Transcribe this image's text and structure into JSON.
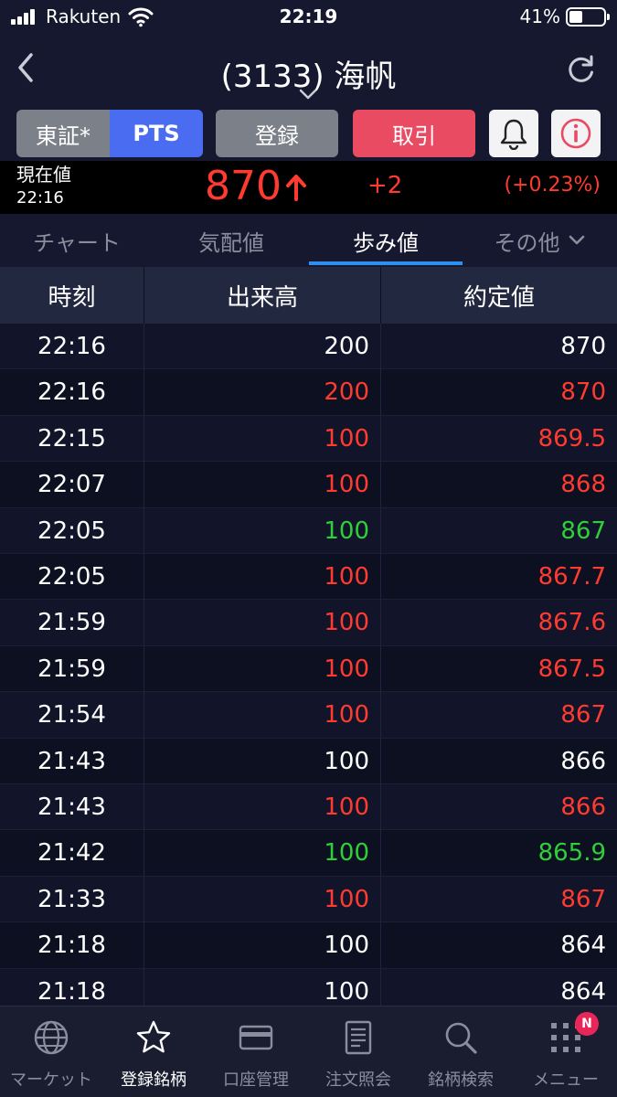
{
  "status_bar": {
    "carrier": "Rakuten",
    "time": "22:19",
    "battery": "41%",
    "battery_level": 0.41
  },
  "header": {
    "title": "(3133) 海帆"
  },
  "buttons": {
    "tosho": "東証*",
    "pts": "PTS",
    "register": "登録",
    "trade": "取引"
  },
  "quote": {
    "label": "現在値",
    "time": "22:16",
    "price": "870",
    "change": "+2",
    "change_pct": "(+0.23%)",
    "up_color": "#ff3b30"
  },
  "tabs": [
    {
      "label": "チャート"
    },
    {
      "label": "気配値"
    },
    {
      "label": "歩み値"
    },
    {
      "label": "その他"
    }
  ],
  "active_tab": "歩み値",
  "table": {
    "headers": {
      "time": "時刻",
      "volume": "出来高",
      "price": "約定値"
    },
    "colors": {
      "white": "#ffffff",
      "red": "#ff3b30",
      "green": "#2fcf3a"
    },
    "rows": [
      {
        "time": "22:16",
        "volume": "200",
        "price": "870",
        "color": "white"
      },
      {
        "time": "22:16",
        "volume": "200",
        "price": "870",
        "color": "red"
      },
      {
        "time": "22:15",
        "volume": "100",
        "price": "869.5",
        "color": "red"
      },
      {
        "time": "22:07",
        "volume": "100",
        "price": "868",
        "color": "red"
      },
      {
        "time": "22:05",
        "volume": "100",
        "price": "867",
        "color": "green"
      },
      {
        "time": "22:05",
        "volume": "100",
        "price": "867.7",
        "color": "red"
      },
      {
        "time": "21:59",
        "volume": "100",
        "price": "867.6",
        "color": "red"
      },
      {
        "time": "21:59",
        "volume": "100",
        "price": "867.5",
        "color": "red"
      },
      {
        "time": "21:54",
        "volume": "100",
        "price": "867",
        "color": "red"
      },
      {
        "time": "21:43",
        "volume": "100",
        "price": "866",
        "color": "white"
      },
      {
        "time": "21:43",
        "volume": "100",
        "price": "866",
        "color": "red"
      },
      {
        "time": "21:42",
        "volume": "100",
        "price": "865.9",
        "color": "green"
      },
      {
        "time": "21:33",
        "volume": "100",
        "price": "867",
        "color": "red"
      },
      {
        "time": "21:18",
        "volume": "100",
        "price": "864",
        "color": "white"
      },
      {
        "time": "21:18",
        "volume": "100",
        "price": "864",
        "color": "white"
      }
    ]
  },
  "tabbar": [
    {
      "label": "マーケット",
      "icon": "globe-icon"
    },
    {
      "label": "登録銘柄",
      "icon": "star-icon"
    },
    {
      "label": "口座管理",
      "icon": "card-icon"
    },
    {
      "label": "注文照会",
      "icon": "document-icon"
    },
    {
      "label": "銘柄検索",
      "icon": "search-icon"
    },
    {
      "label": "メニュー",
      "icon": "grid-menu-icon",
      "badge": "N"
    }
  ],
  "active_tabbar": "登録銘柄"
}
